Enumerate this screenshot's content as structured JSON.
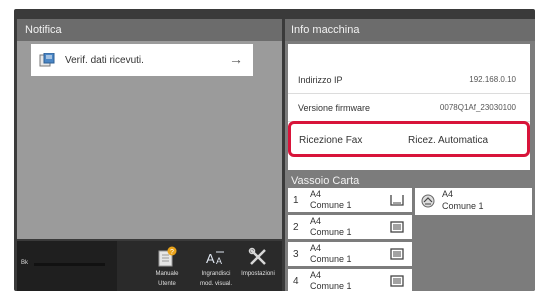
{
  "notifica": {
    "header": "Notifica",
    "message": "Verif. dati ricevuti.",
    "arrow": "→"
  },
  "status_bar": {
    "toner_label": "Bk"
  },
  "tools": [
    {
      "label_line1": "Manuale",
      "label_line2": "Utente",
      "icon": "manual-icon"
    },
    {
      "label_line1": "Ingrandisci",
      "label_line2": "mod. visual.",
      "icon": "text-size-icon"
    },
    {
      "label_line1": "Impostazioni",
      "label_line2": "",
      "icon": "settings-icon"
    }
  ],
  "info_macchina": {
    "header": "Info macchina",
    "rows": [
      {
        "label": "Indirizzo IP",
        "value": "192.168.0.10"
      },
      {
        "label": "Versione firmware",
        "value": "0078Q1Af_23030100"
      }
    ],
    "fax": {
      "label": "Ricezione Fax",
      "value": "Ricez. Automatica"
    },
    "highlight_color": "#d8143a"
  },
  "vassoio_carta": {
    "header": "Vassoio Carta",
    "trays": [
      {
        "number": "1",
        "size": "A4",
        "type": "Comune 1",
        "icon": "tray-low-icon"
      },
      {
        "number": "2",
        "size": "A4",
        "type": "Comune 1",
        "icon": "tray-full-icon"
      },
      {
        "number": "3",
        "size": "A4",
        "type": "Comune 1",
        "icon": "tray-full-icon"
      },
      {
        "number": "4",
        "size": "A4",
        "type": "Comune 1",
        "icon": "tray-full-icon"
      }
    ],
    "bypass": {
      "size": "A4",
      "type": "Comune 1",
      "icon": "bypass-tray-icon"
    }
  }
}
